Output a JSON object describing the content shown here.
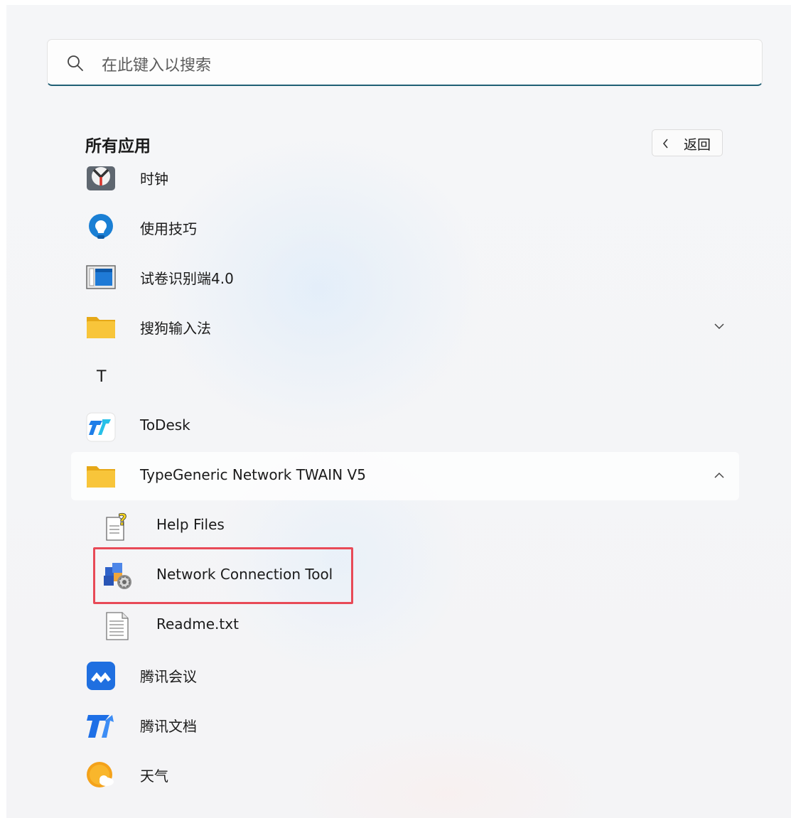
{
  "search": {
    "placeholder": "在此键入以搜索",
    "icon": "search-icon"
  },
  "header": {
    "title": "所有应用",
    "back_label": "返回"
  },
  "letter_T": "T",
  "apps": [
    {
      "label": "时钟",
      "icon": "clock-icon"
    },
    {
      "label": "使用技巧",
      "icon": "tips-icon"
    },
    {
      "label": "试卷识别端4.0",
      "icon": "app-window-icon"
    },
    {
      "label": "搜狗输入法",
      "icon": "folder-icon",
      "expander": "chevron-down-icon"
    },
    {
      "label": "ToDesk",
      "icon": "todesk-icon"
    },
    {
      "label": "TypeGeneric Network TWAIN V5",
      "icon": "folder-icon",
      "expander": "chevron-up-icon"
    },
    {
      "label": "Help Files",
      "icon": "help-file-icon"
    },
    {
      "label": "Network Connection Tool",
      "icon": "network-tool-icon",
      "highlighted": true
    },
    {
      "label": "Readme.txt",
      "icon": "text-file-icon"
    },
    {
      "label": "腾讯会议",
      "icon": "tencent-meeting-icon"
    },
    {
      "label": "腾讯文档",
      "icon": "tencent-docs-icon"
    },
    {
      "label": "天气",
      "icon": "weather-icon"
    }
  ],
  "colors": {
    "search_underline": "#1f5f74",
    "highlight_box": "#e84a57",
    "folder": "#f8c53a"
  }
}
